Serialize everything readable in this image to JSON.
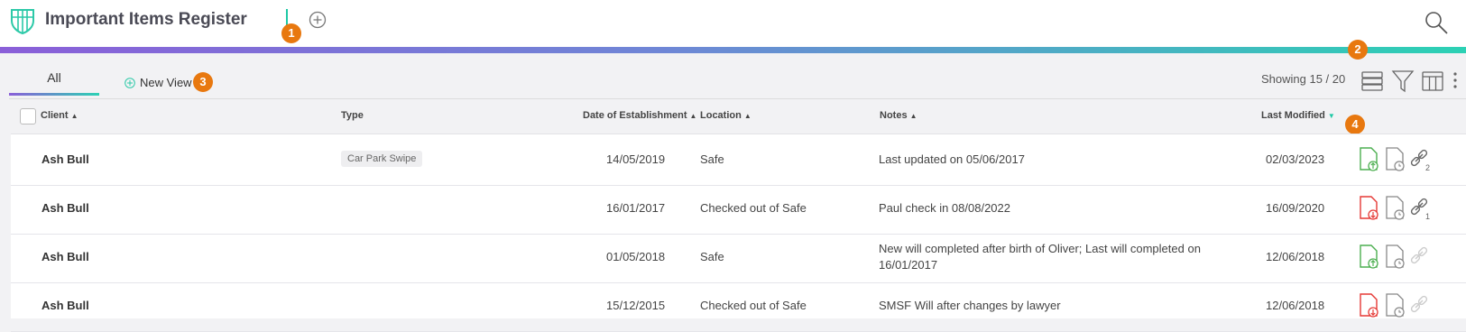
{
  "app": {
    "title": "Important Items Register"
  },
  "tour_badges": [
    "1",
    "2",
    "3",
    "4"
  ],
  "tabs": {
    "all_label": "All",
    "new_view_label": "New View"
  },
  "toolbar": {
    "showing_text": "Showing 15 / 20"
  },
  "columns": {
    "client": "Client",
    "type": "Type",
    "date": "Date of Establishment",
    "location": "Location",
    "notes": "Notes",
    "modified": "Last Modified"
  },
  "colors": {
    "upload_green": "#4caf50",
    "download_red": "#e53935",
    "accent_teal": "#1ec8a5",
    "accent_purple": "#8a5fd8",
    "badge_orange": "#e8780f"
  },
  "rows": [
    {
      "client": "Ash Bull",
      "type": "Car Park Swipe",
      "date": "14/05/2019",
      "location": "Safe",
      "notes": "Last updated on 05/06/2017",
      "modified": "02/03/2023",
      "status": "in",
      "link_count": "2"
    },
    {
      "client": "Ash Bull",
      "type": "",
      "date": "16/01/2017",
      "location": "Checked out of Safe",
      "notes": "Paul check in 08/08/2022",
      "modified": "16/09/2020",
      "status": "out",
      "link_count": "1"
    },
    {
      "client": "Ash Bull",
      "type": "",
      "date": "01/05/2018",
      "location": "Safe",
      "notes": "New will completed after birth of Oliver; Last will completed on 16/01/2017",
      "modified": "12/06/2018",
      "status": "in",
      "link_count": ""
    },
    {
      "client": "Ash Bull",
      "type": "",
      "date": "15/12/2015",
      "location": "Checked out of Safe",
      "notes": "SMSF Will after changes by lawyer",
      "modified": "12/06/2018",
      "status": "out",
      "link_count": ""
    }
  ]
}
